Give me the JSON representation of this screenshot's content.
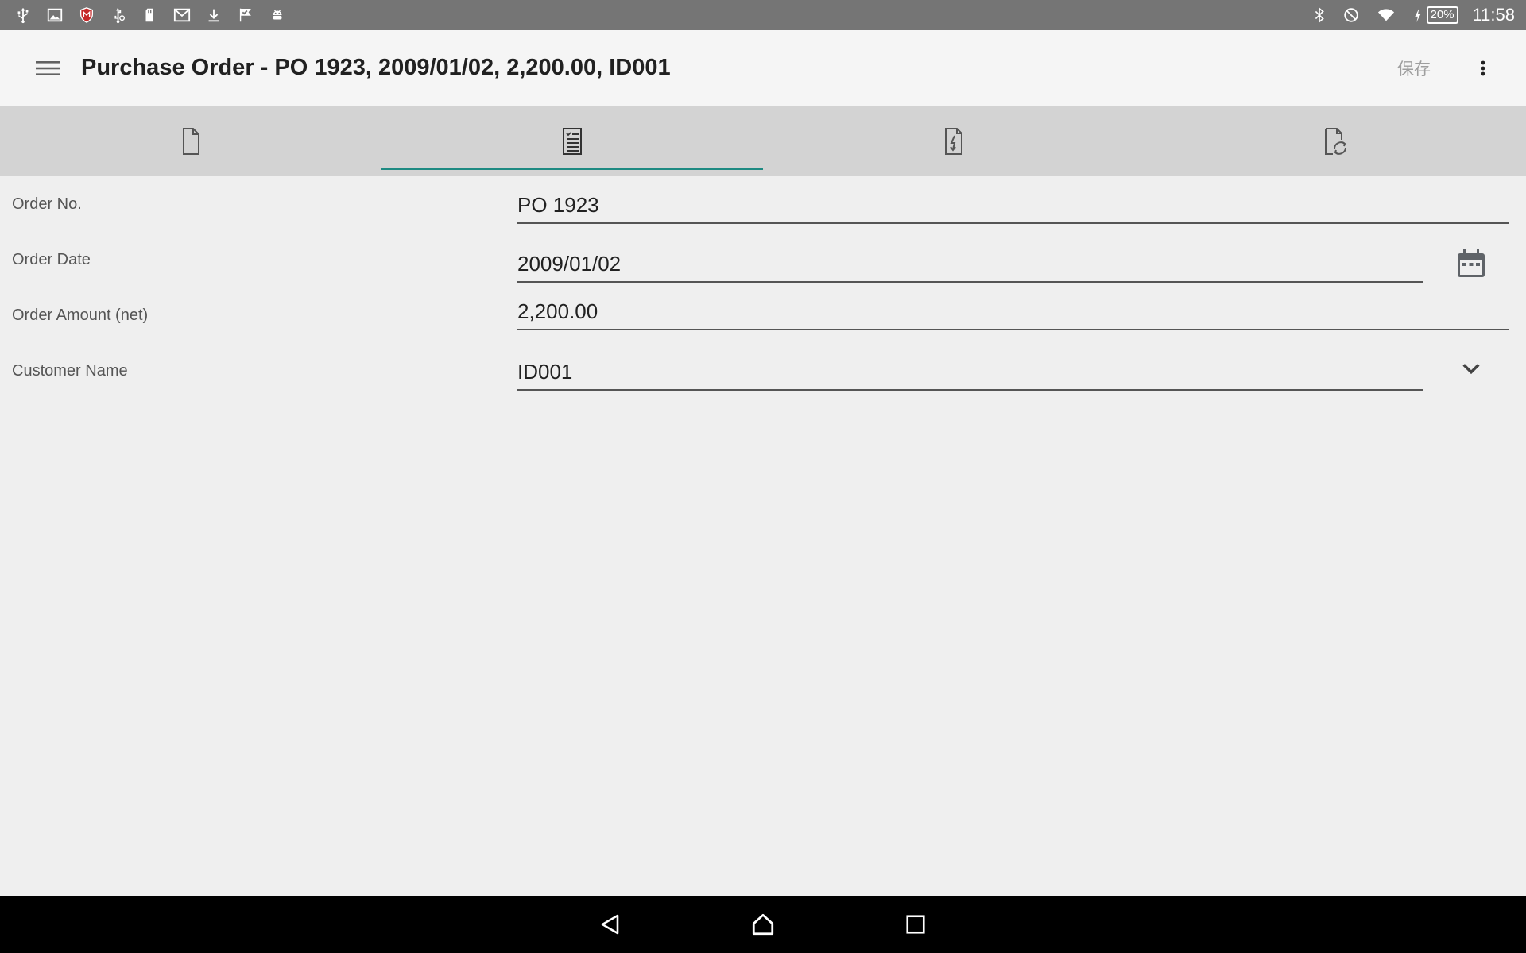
{
  "status_bar": {
    "left_icons": [
      "usb-icon",
      "image-icon",
      "mcafee-shield-icon",
      "usb-debug-icon",
      "sd-card-icon",
      "gmail-icon",
      "download-icon",
      "check-flag-icon",
      "android-icon"
    ],
    "right_icons": [
      "bluetooth-icon",
      "do-not-disturb-icon",
      "wifi-icon",
      "charging-icon"
    ],
    "battery": "20%",
    "time": "11:58"
  },
  "app_bar": {
    "title": "Purchase Order - PO 1923, 2009/01/02, 2,200.00, ID001",
    "save_label": "保存"
  },
  "tabs": [
    {
      "icon": "document-icon",
      "active": false
    },
    {
      "icon": "checklist-document-icon",
      "active": true
    },
    {
      "icon": "document-export-icon",
      "active": false
    },
    {
      "icon": "document-refresh-icon",
      "active": false
    }
  ],
  "form": {
    "order_no": {
      "label": "Order No.",
      "value": "PO 1923"
    },
    "order_date": {
      "label": "Order Date",
      "value": "2009/01/02"
    },
    "order_amount": {
      "label": "Order Amount (net)",
      "value": "2,200.00"
    },
    "customer_name": {
      "label": "Customer Name",
      "value": "ID001"
    }
  },
  "colors": {
    "accent": "#1e8a82",
    "status_bar": "#757575",
    "tab_bar": "#d3d3d3",
    "background": "#efefef"
  }
}
